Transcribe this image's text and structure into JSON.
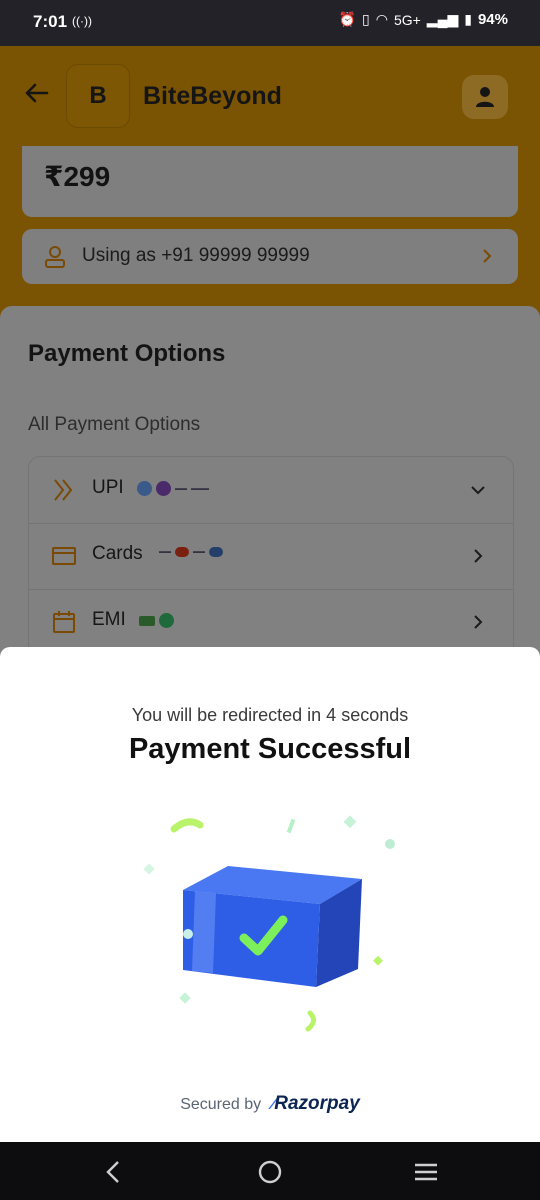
{
  "status_bar": {
    "time": "7:01",
    "network": "5G+",
    "battery": "94%"
  },
  "header": {
    "logo_letter": "B",
    "brand": "BiteBeyond"
  },
  "amount": "₹299",
  "using_as": "Using as +91 99999 99999",
  "payment_options": {
    "title": "Payment Options",
    "subtitle": "All Payment Options",
    "items": [
      {
        "label": "UPI",
        "icon": "upi-icon"
      },
      {
        "label": "Cards",
        "icon": "card-icon"
      },
      {
        "label": "EMI",
        "icon": "calendar-icon"
      }
    ]
  },
  "modal": {
    "redirect_text": "You will be redirected in 4 seconds",
    "title": "Payment Successful",
    "secured_by": "Secured by",
    "provider": "Razorpay"
  },
  "colors": {
    "brand_bg": "#7a5402",
    "success_blue": "#2f5ee6",
    "check_green": "#7bf05a"
  }
}
